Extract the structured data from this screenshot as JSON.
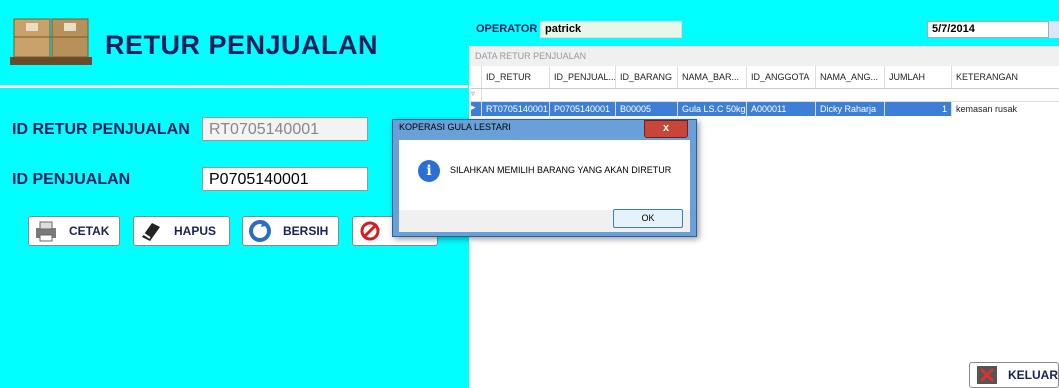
{
  "header": {
    "title": "RETUR PENJUALAN"
  },
  "form": {
    "retur_label": "ID RETUR PENJUALAN",
    "retur_value": "RT0705140001",
    "penjualan_label": "ID PENJUALAN",
    "penjualan_value": "P0705140001"
  },
  "buttons": {
    "cetak": "CETAK",
    "hapus": "HAPUS",
    "bersih": "BERSIH",
    "keluar": "KELUAR"
  },
  "topbar": {
    "operator_label": "OPERATOR",
    "operator_value": "patrick",
    "date": "5/7/2014"
  },
  "panel": {
    "title": "DATA RETUR PENJUALAN"
  },
  "table": {
    "columns": [
      "ID_RETUR",
      "ID_PENJUAL...",
      "ID_BARANG",
      "NAMA_BAR...",
      "ID_ANGGOTA",
      "NAMA_ANG...",
      "JUMLAH",
      "KETERANGAN"
    ],
    "rows": [
      [
        "RT0705140001",
        "P0705140001",
        "B00005",
        "Gula LS.C 50kg",
        "A000011",
        "Dicky Raharja",
        "1",
        "kemasan rusak"
      ]
    ]
  },
  "dialog": {
    "title": "KOPERASI GULA LESTARI",
    "close": "x",
    "message": "SILAHKAN MEMILIH BARANG YANG AKAN DIRETUR",
    "ok": "OK",
    "icon_glyph": "i"
  },
  "colors": {
    "background": "#00ffff",
    "title": "#1a1f5c",
    "selected_row": "#3d7fd6"
  }
}
